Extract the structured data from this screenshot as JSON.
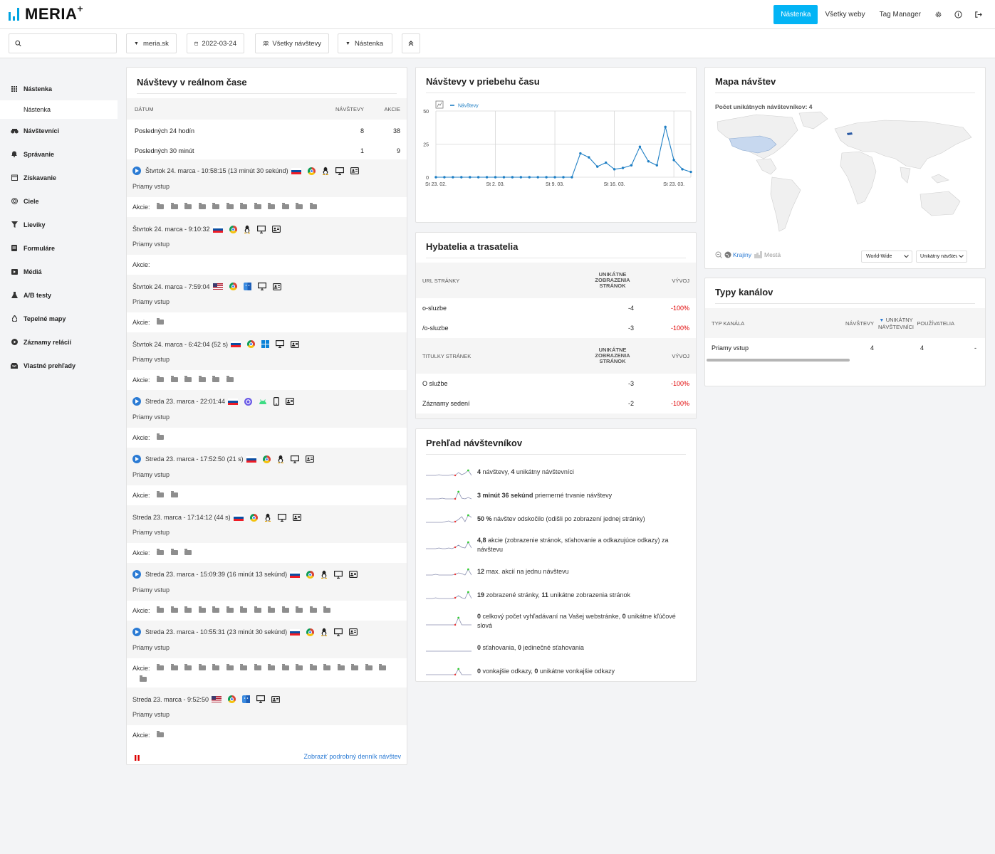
{
  "brand": {
    "name": "MERIA",
    "plus": "+"
  },
  "topnav": {
    "items": [
      {
        "label": "Nástenka",
        "active": true
      },
      {
        "label": "Všetky weby",
        "active": false
      },
      {
        "label": "Tag Manager",
        "active": false
      }
    ],
    "icons": [
      "gear-icon",
      "info-icon",
      "logout-icon"
    ]
  },
  "toolbar": {
    "search_placeholder": "",
    "site": "meria.sk",
    "date": "2022-03-24",
    "segment": "Všetky návštevy",
    "dashboard": "Nástenka"
  },
  "sidebar": {
    "items": [
      {
        "label": "Nástenka",
        "icon": "grid-icon"
      },
      {
        "label": "Nástenka",
        "icon": ""
      },
      {
        "label": "Návštevníci",
        "icon": "binoculars-icon"
      },
      {
        "label": "Správanie",
        "icon": "bell-icon"
      },
      {
        "label": "Získavanie",
        "icon": "calendar-icon"
      },
      {
        "label": "Ciele",
        "icon": "target-icon"
      },
      {
        "label": "Lieviky",
        "icon": "funnel-icon"
      },
      {
        "label": "Formuláre",
        "icon": "form-icon"
      },
      {
        "label": "Médiá",
        "icon": "media-icon"
      },
      {
        "label": "A/B testy",
        "icon": "flask-icon"
      },
      {
        "label": "Tepelné mapy",
        "icon": "drop-icon"
      },
      {
        "label": "Záznamy relácií",
        "icon": "play-circle-icon"
      },
      {
        "label": "Vlastné prehľady",
        "icon": "inbox-icon"
      }
    ]
  },
  "realtime": {
    "title": "Návštevy v reálnom čase",
    "headers": {
      "date": "DÁTUM",
      "visits": "NÁVŠTEVY",
      "actions": "AKCIE"
    },
    "rows": [
      {
        "label": "Posledných 24 hodín",
        "visits": "8",
        "actions": "38"
      },
      {
        "label": "Posledných 30 minút",
        "visits": "1",
        "actions": "9"
      }
    ],
    "visits": [
      {
        "time": "Štvrtok 24. marca - 10:58:15 (13 minút 30 sekúnd)",
        "play": true,
        "flag": "sk",
        "browser": "chrome",
        "os": "linux",
        "ref": "Priamy vstup",
        "actions_label": "Akcie:",
        "actions": 12
      },
      {
        "time": "Štvrtok 24. marca - 9:10:32",
        "play": false,
        "flag": "sk",
        "browser": "chrome",
        "os": "linux",
        "ref": "Priamy vstup",
        "actions_label": "Akcie:",
        "actions": 0
      },
      {
        "time": "Štvrtok 24. marca - 7:59:04",
        "play": false,
        "flag": "us",
        "browser": "chrome",
        "os": "mac",
        "ref": "Priamy vstup",
        "actions_label": "Akcie:",
        "actions": 1
      },
      {
        "time": "Štvrtok 24. marca - 6:42:04 (52 s)",
        "play": false,
        "flag": "sk",
        "browser": "chrome",
        "os": "windows",
        "ref": "Priamy vstup",
        "actions_label": "Akcie:",
        "actions": 6
      },
      {
        "time": "Streda 23. marca - 22:01:44",
        "play": true,
        "flag": "sk",
        "browser": "samsung",
        "os": "android",
        "device": "mobile",
        "ref": "Priamy vstup",
        "actions_label": "Akcie:",
        "actions": 1
      },
      {
        "time": "Streda 23. marca - 17:52:50 (21 s)",
        "play": true,
        "flag": "sk",
        "browser": "chrome",
        "os": "linux",
        "ref": "Priamy vstup",
        "actions_label": "Akcie:",
        "actions": 2
      },
      {
        "time": "Streda 23. marca - 17:14:12 (44 s)",
        "play": false,
        "flag": "sk",
        "browser": "chrome",
        "os": "linux",
        "ref": "Priamy vstup",
        "actions_label": "Akcie:",
        "actions": 3
      },
      {
        "time": "Streda 23. marca - 15:09:39 (16 minút 13 sekúnd)",
        "play": true,
        "flag": "sk",
        "browser": "chrome",
        "os": "linux",
        "ref": "Priamy vstup",
        "actions_label": "Akcie:",
        "actions": 13
      },
      {
        "time": "Streda 23. marca - 10:55:31 (23 minút 30 sekúnd)",
        "play": true,
        "flag": "sk",
        "browser": "chrome",
        "os": "linux",
        "ref": "Priamy vstup",
        "actions_label": "Akcie:",
        "actions": 18
      },
      {
        "time": "Streda 23. marca - 9:52:50",
        "play": false,
        "flag": "us",
        "browser": "chrome",
        "os": "mac",
        "ref": "Priamy vstup",
        "actions_label": "Akcie:",
        "actions": 1
      }
    ],
    "footer_link": "Zobraziť podrobný denník návštev"
  },
  "overtime": {
    "title": "Návštevy v priebehu času",
    "chart_data": {
      "type": "line",
      "title": "",
      "series": [
        {
          "name": "Návštevy",
          "values": [
            0,
            0,
            0,
            0,
            0,
            0,
            0,
            0,
            0,
            0,
            0,
            0,
            0,
            0,
            0,
            0,
            0,
            18,
            15,
            8,
            11,
            6,
            7,
            9,
            23,
            12,
            9,
            38,
            13,
            6,
            4
          ]
        }
      ],
      "x_tick_labels": [
        "St 23. 02.",
        "St 2. 03.",
        "St 9. 03.",
        "St 16. 03.",
        "St 23. 03."
      ],
      "y_ticks": [
        0,
        25,
        50
      ],
      "ylim": [
        0,
        50
      ],
      "grid": true,
      "color": "#1f7fc4"
    }
  },
  "engagement": {
    "title": "Hybatelia a trasatelia",
    "url_headers": {
      "col1": "URL STRÁNKY",
      "col2": "UNIKÁTNE ZOBRAZENIA STRÁNOK",
      "col3": "VÝVOJ"
    },
    "url_rows": [
      {
        "label": "o-sluzbe",
        "value": "-4",
        "trend": "-100%"
      },
      {
        "label": "/o-sluzbe",
        "value": "-3",
        "trend": "-100%"
      }
    ],
    "title_headers": {
      "col1": "TITULKY STRÁNEK",
      "col2": "UNIKÁTNE ZOBRAZENIA STRÁNOK",
      "col3": "VÝVOJ"
    },
    "title_rows": [
      {
        "label": "O službe",
        "value": "-3",
        "trend": "-100%"
      },
      {
        "label": "Záznamy sedení",
        "value": "-2",
        "trend": "-100%"
      }
    ]
  },
  "overview": {
    "title": "Prehľad návštevníkov",
    "items": [
      {
        "parts": [
          {
            "b": "4"
          },
          {
            "t": " návštevy, "
          },
          {
            "b": "4"
          },
          {
            "t": " unikátny návštevníci"
          }
        ]
      },
      {
        "parts": [
          {
            "b": "3 minút 36 sekúnd"
          },
          {
            "t": " priemerné trvanie návštevy"
          }
        ]
      },
      {
        "parts": [
          {
            "b": "50 %"
          },
          {
            "t": " návštev odskočilo (odišli po zobrazení jednej stránky)"
          }
        ]
      },
      {
        "parts": [
          {
            "b": "4,8"
          },
          {
            "t": " akcie (zobrazenie stránok, sťahovanie a odkazujúce odkazy) za návštevu"
          }
        ]
      },
      {
        "parts": [
          {
            "b": "12"
          },
          {
            "t": " max. akcií na jednu návštevu"
          }
        ]
      },
      {
        "parts": [
          {
            "b": "19"
          },
          {
            "t": " zobrazené stránky, "
          },
          {
            "b": "11"
          },
          {
            "t": " unikátne zobrazenia stránok"
          }
        ]
      },
      {
        "parts": [
          {
            "b": "0"
          },
          {
            "t": " celkový počet vyhľadávaní na Vašej webstránke, "
          },
          {
            "b": "0"
          },
          {
            "t": " unikátne kľúčové slová"
          }
        ]
      },
      {
        "parts": [
          {
            "b": "0"
          },
          {
            "t": " sťahovania, "
          },
          {
            "b": "0"
          },
          {
            "t": " jedinečné sťahovania"
          }
        ]
      },
      {
        "parts": [
          {
            "b": "0"
          },
          {
            "t": " vonkajšie odkazy, "
          },
          {
            "b": "0"
          },
          {
            "t": " unikátne vonkajšie odkazy"
          }
        ]
      }
    ]
  },
  "map": {
    "title": "Mapa návštev",
    "unique_label": "Počet unikátnych návštevníkov: 4",
    "countries_label": "Krajiny",
    "cities_label": "Mestá",
    "region_select": "World-Wide",
    "metric_select": "Unikátny návštev",
    "highlight_color": "#c7d8ef"
  },
  "channels": {
    "title": "Typy kanálov",
    "headers": {
      "type": "TYP KANÁLA",
      "visits": "NÁVŠTEVY",
      "unique": "UNIKÁTNY NÁVŠTEVNÍCI",
      "users": "POUŽÍVATELIA"
    },
    "rows": [
      {
        "type": "Priamy vstup",
        "visits": "4",
        "unique": "4",
        "users": "-"
      }
    ]
  },
  "colors": {
    "accent": "#03b4f5",
    "link": "#2b7bd4",
    "negative": "#e00000"
  }
}
